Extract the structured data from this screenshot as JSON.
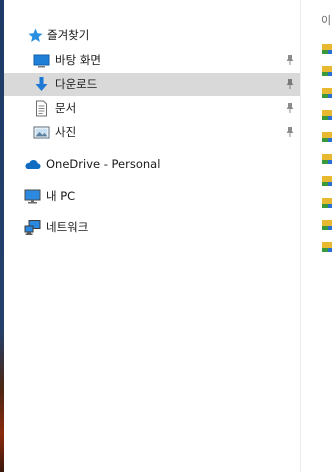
{
  "nav": {
    "quick_access": {
      "label": "즐겨찾기",
      "items": [
        {
          "label": "바탕 화면",
          "pinned": true,
          "icon": "desktop-icon"
        },
        {
          "label": "다운로드",
          "pinned": true,
          "icon": "download-icon",
          "selected": true
        },
        {
          "label": "문서",
          "pinned": true,
          "icon": "document-icon"
        },
        {
          "label": "사진",
          "pinned": true,
          "icon": "picture-icon"
        }
      ]
    },
    "onedrive": {
      "label": "OneDrive - Personal",
      "icon": "cloud-icon"
    },
    "this_pc": {
      "label": "내 PC",
      "icon": "monitor-icon"
    },
    "network": {
      "label": "네트워크",
      "icon": "network-icon"
    }
  },
  "content": {
    "column_header": "이",
    "file_icon": "folder-file-icon"
  },
  "colors": {
    "selection": "#d9d9d9",
    "star": "#2b8fe0",
    "accent_blue": "#1e78d4"
  }
}
